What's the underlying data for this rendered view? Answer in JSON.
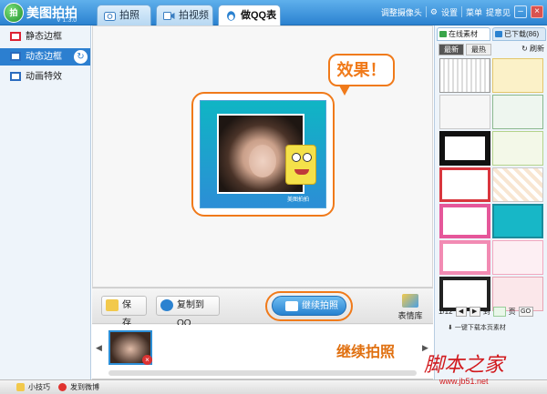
{
  "app": {
    "logo_text": "拍",
    "name": "美图拍拍",
    "version": "V 1.3.0",
    "brand_color": "#2b82d0",
    "accent_color": "#f07a1a"
  },
  "tabs": [
    {
      "label": "拍照",
      "icon": "camera-icon",
      "active": false
    },
    {
      "label": "拍视频",
      "icon": "video-icon",
      "active": false
    },
    {
      "label": "做QQ表情",
      "icon": "qq-penguin-icon",
      "active": true
    }
  ],
  "toolbar_top": {
    "adjust_camera": "调整摄像头",
    "settings": "设置",
    "menu": "菜单",
    "feedback": "提意见"
  },
  "sidebar": {
    "items": [
      {
        "label": "静态边框",
        "icon": "static-frame-icon",
        "active": false
      },
      {
        "label": "动态边框",
        "icon": "dynamic-frame-icon",
        "active": true
      },
      {
        "label": "动画特效",
        "icon": "animation-effect-icon",
        "active": false
      }
    ]
  },
  "canvas": {
    "callout_effect": "效果！",
    "watermark_mark": "美图拍拍"
  },
  "actions": {
    "save": "保 存",
    "copy_to_qq": "复制到QQ",
    "continue_shoot": "继续拍照",
    "emoji_library": "表情库"
  },
  "strip_callout": "继续拍照",
  "right_panel": {
    "tab_online": "在线素材",
    "tab_downloaded": "已下载(86)",
    "sub_newest": "最新",
    "sub_hottest": "最热",
    "refresh": "刷新",
    "pager": {
      "current": "1/12",
      "goto_label": "到",
      "page_unit": "页",
      "go": "GO"
    },
    "download_all": "一键下载本页素材"
  },
  "status": {
    "tips": "小技巧",
    "post_weibo": "发到微博"
  },
  "watermark": {
    "text": "脚本之家",
    "url": "www.jb51.net"
  }
}
